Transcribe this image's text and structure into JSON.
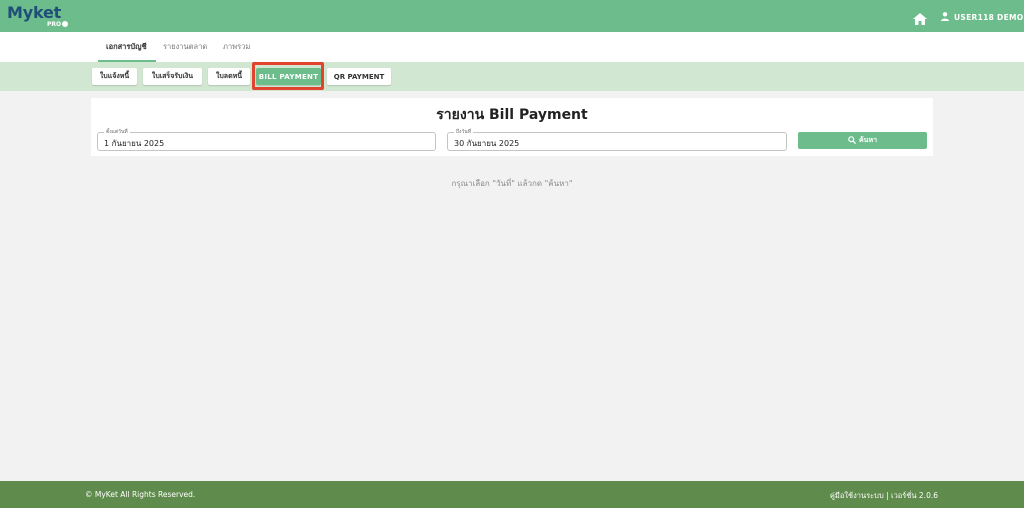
{
  "header": {
    "logo_text": "Myket",
    "logo_sub": "PRO",
    "user_name": "USER118 DEMO",
    "colors": {
      "topbar": "#6cbd8b",
      "logo": "#1f4e79"
    },
    "icons": {
      "home": "home-icon",
      "user": "user-icon"
    }
  },
  "tabs": [
    {
      "label": "เอกสารบัญชี",
      "active": true
    },
    {
      "label": "รายงานตลาด",
      "active": false
    },
    {
      "label": "ภาพรวม",
      "active": false
    }
  ],
  "doc_types": [
    {
      "label": "ใบแจ้งหนี้",
      "selected": false
    },
    {
      "label": "ใบเสร็จรับเงิน",
      "selected": false
    },
    {
      "label": "ใบลดหนี้",
      "selected": false
    },
    {
      "label": "BILL PAYMENT",
      "selected": true
    },
    {
      "label": "QR PAYMENT",
      "selected": false
    }
  ],
  "report": {
    "title": "รายงาน Bill Payment",
    "start_label": "ตั้งแต่วันที่",
    "start_value": "1 กันยายน 2025",
    "end_label": "ถึงวันที่",
    "end_value": "30 กันยายน 2025",
    "search_label": "ค้นหา",
    "search_icon": "search-icon",
    "hint": "กรุณาเลือก \"วันที่\" แล้วกด \"ค้นหา\""
  },
  "footer": {
    "copyright": "© MyKet All Rights Reserved.",
    "manual_label": "คู่มือใช้งานระบบ",
    "separator": " | ",
    "version": "เวอร์ชั่น 2.0.6",
    "color": "#5f8b4c"
  },
  "highlight_color": "#e0442f"
}
